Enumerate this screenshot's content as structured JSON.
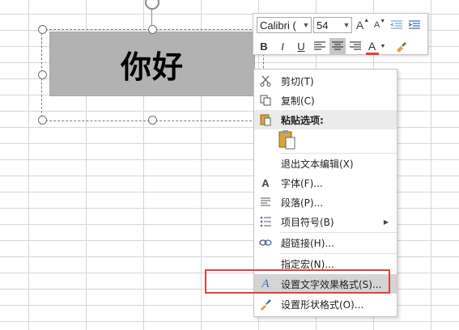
{
  "shape": {
    "text": "你好"
  },
  "mini_toolbar": {
    "font_name": "Calibri (",
    "font_size": "54",
    "grow_font": "A",
    "shrink_font": "A",
    "bold": "B",
    "italic": "I",
    "underline": "U",
    "font_color": "A",
    "font_color_accent": "#e0403d"
  },
  "context_menu": {
    "items": [
      {
        "label": "剪切(T)",
        "icon": "scissors-icon"
      },
      {
        "label": "复制(C)",
        "icon": "copy-icon"
      },
      {
        "label": "粘贴选项:",
        "icon": "paste-icon"
      },
      {
        "label": "退出文本编辑(X)",
        "icon": ""
      },
      {
        "label": "字体(F)...",
        "icon": "font-icon"
      },
      {
        "label": "段落(P)...",
        "icon": "paragraph-icon"
      },
      {
        "label": "项目符号(B)",
        "icon": "bullets-icon"
      },
      {
        "label": "超链接(H)...",
        "icon": "hyperlink-icon"
      },
      {
        "label": "指定宏(N)...",
        "icon": ""
      },
      {
        "label": "设置文字效果格式(S)...",
        "icon": "text-effects-icon"
      },
      {
        "label": "设置形状格式(O)...",
        "icon": "shape-format-icon"
      }
    ]
  },
  "colors": {
    "highlight_box": "#e0403d",
    "shape_fill": "#b2b2b2"
  }
}
